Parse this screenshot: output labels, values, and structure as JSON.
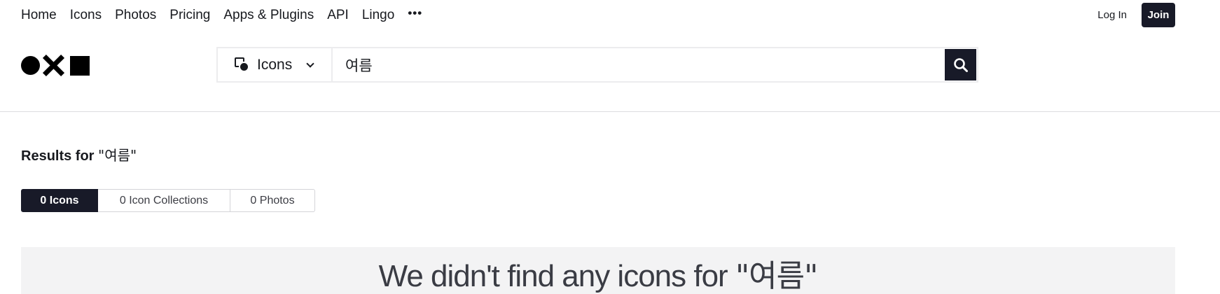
{
  "nav": {
    "items": [
      "Home",
      "Icons",
      "Photos",
      "Pricing",
      "Apps & Plugins",
      "API",
      "Lingo"
    ],
    "more": "•••"
  },
  "auth": {
    "login": "Log In",
    "join": "Join"
  },
  "search": {
    "type_label": "Icons",
    "type_icon": "icons-shape-icon",
    "query": "여름",
    "button_icon": "search-icon"
  },
  "results": {
    "prefix": "Results for ",
    "query": "\"여름\""
  },
  "tabs": [
    {
      "label": "0 Icons",
      "active": true
    },
    {
      "label": "0 Icon Collections",
      "active": false
    },
    {
      "label": "0 Photos",
      "active": false
    }
  ],
  "empty": {
    "prefix": "We didn't find any icons for ",
    "query": "\"여름\""
  },
  "colors": {
    "accent": "#181a28",
    "panel": "#f3f3f4",
    "border": "#ececee"
  }
}
